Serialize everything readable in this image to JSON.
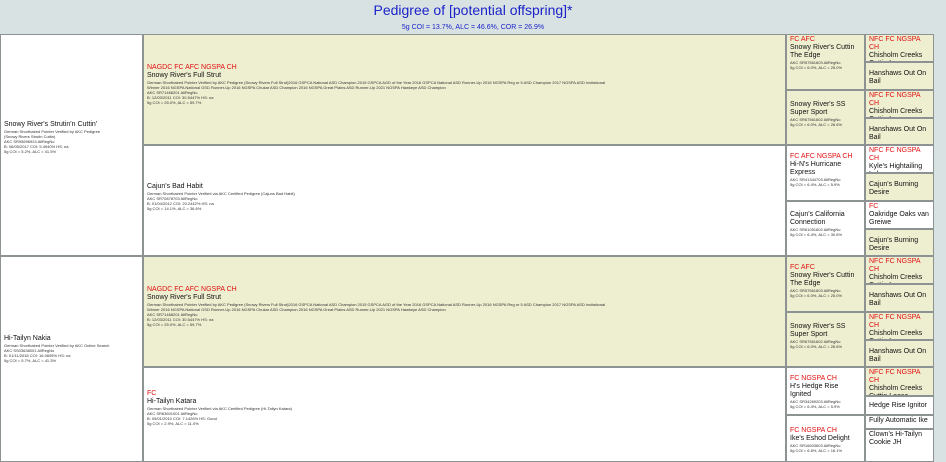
{
  "header": {
    "title": "Pedigree of [potential offspring]*",
    "stats": "5g COI = 13.7%, ALC = 46.6%, COR = 26.9%"
  },
  "sire": {
    "name": "Snowy River's Strutin'n Cuttin'",
    "desc": "German Shorthaired Pointer Verified by AKC Pedigree",
    "desc2": "(Snowy Rivers Strutin Cuttin)",
    "reg": "AKC SR95696924 AllRegNo",
    "dob": "B: 06/05/2017 COI: 5.4940% HS: na",
    "coi": "5g COI = 5.2%, ALC = 41.5%",
    "sire": {
      "title": "NAGDC FC AFC NGSPA CH",
      "name": "Snowy River's Full Strut",
      "desc": "German Shorthaired Pointer Verified by AKC Pedigree (Snowy Rivers Full Strut)2016 GSPCA National ASD Champion 2015 GSPCA AGD of the Year 2016 GSPCA National ASD Runner-Up 2016 NGSPA Reg or 5 ASD Champion 2017 NGSPA ASD Invitational",
      "desc2": "Winner 2016 NGSPA National GSD Runner-Up 2016 NGSPA Chukar ASD Champion 2016 NGSPA Great Plains ASD Runner-Up 2021 NGSPA Hawkeye ASD Champion",
      "reg": "AKC SR71468201 AllRegNo",
      "dob": "B: 12/03/2011 COI: 30.5447% HS: na",
      "coi": "5g COI = 25.0%, ALC = 59.7%",
      "sire": {
        "title": "FC AFC",
        "name": "Snowy River's Cuttin The Edge",
        "reg": "AKC SR57561603 AllRegNo",
        "coi": "5g COI = 6.0%, ALC = 25.0%",
        "sire": {
          "title": "NFC FC NGSPA CH",
          "name": "Chisholm Creeks Cuttin Loose"
        },
        "dam": {
          "title": "",
          "name": "Hanshaws Out On Bail"
        }
      },
      "dam": {
        "title": "",
        "name": "Snowy River's SS Super Sport",
        "reg": "AKC SR67561602 AllRegNo",
        "coi": "5g COI = 6.0%, ALC = 26.6%",
        "sire": {
          "title": "NFC FC NGSPA CH",
          "name": "Chisholm Creeks Cuttin Loose"
        },
        "dam": {
          "title": "",
          "name": "Hanshaws Out On Bail"
        }
      }
    },
    "dam": {
      "title": "",
      "name": "Cajun's Bad Habit",
      "desc": "German Shorthaired Pointer Verified via AKC Certified Pedigree (Cajuns Bad Habit)",
      "reg": "AKC SR70878703 AllRegNo",
      "dob": "B: 01/04/2012 COI: 20.2442% HS: na",
      "coi": "5g COI = 14.1%, ALC = 36.6%",
      "sire": {
        "title": "FC AFC NGSPA CH",
        "name": "Hi-N's Hurricane Express",
        "reg": "AKC SR41344703 AllRegNo",
        "coi": "5g COI = 6.4%, ALC = 5.9%",
        "sire": {
          "title": "NFC FC NGSPA CH",
          "name": "Kyle's Hightailing Luke"
        },
        "dam": {
          "title": "",
          "name": "Cajun's Burning Desire"
        }
      },
      "dam": {
        "title": "",
        "name": "Cajun's California Connection",
        "reg": "AKC SR61051602 AllRegNo",
        "coi": "5g COI = 6.4%, ALC = 30.6%",
        "sire": {
          "title": "FC",
          "name": "Oakridge Oaks van Greiwe"
        },
        "dam": {
          "title": "",
          "name": "Cajun's Burning Desire"
        }
      }
    }
  },
  "dam": {
    "name": "Hi-Tailyn Nakia",
    "desc": "German Shorthaired Pointer Verified by AKC Online Search",
    "reg": "AKC SS03638001 AllRegNo",
    "dob": "B: 01/11/2018 COI: 16.0695% HS: na",
    "coi": "5g COI = 5.7%, ALC = 41.3%",
    "sire": {
      "title": "NAGDC FC AFC NGSPA CH",
      "name": "Snowy River's Full Strut",
      "desc": "German Shorthaired Pointer Verified by AKC Pedigree (Snowy Rivers Full Strut)2016 GSPCA National ASD Champion 2015 GSPCA AGD of the Year 2016 GSPCA National ASD Runner-Up 2016 NGSPA Reg or 5 ASD Champion 2017 NGSPA ASD Invitational",
      "desc2": "Winner 2016 NGSPA National GSD Runner-Up 2016 NGSPA Chukar ASD Champion 2016 NGSPA Great Plains ASD Runner-Up 2021 NGSPA Hawkeye ASD Champion",
      "reg": "AKC SR71468201 AllRegNo",
      "dob": "B: 12/03/2011 COI: 30.5447% HS: na",
      "coi": "5g COI = 25.0%, ALC = 59.7%",
      "sire": {
        "title": "FC AFC",
        "name": "Snowy River's Cuttin The Edge",
        "reg": "AKC SR57561603 AllRegNo",
        "coi": "5g COI = 6.0%, ALC = 25.0%",
        "sire": {
          "title": "NFC FC NGSPA CH",
          "name": "Chisholm Creeks Cuttin Loose"
        },
        "dam": {
          "title": "",
          "name": "Hanshaws Out On Bail"
        }
      },
      "dam": {
        "title": "",
        "name": "Snowy River's SS Super Sport",
        "reg": "AKC SR67561602 AllRegNo",
        "coi": "5g COI = 6.0%, ALC = 26.6%",
        "sire": {
          "title": "NFC FC NGSPA CH",
          "name": "Chisholm Creeks Cuttin Loose"
        },
        "dam": {
          "title": "",
          "name": "Hanshaws Out On Bail"
        }
      }
    },
    "dam": {
      "title": "FC",
      "name": "Hi-Tailyn Katara",
      "desc": "German Shorthaired Pointer Verified via AKC Certified Pedigree (Hi-Tailyn Katara)",
      "reg": "AKC SR63601001 AllRegNo",
      "dob": "B: 05/01/2010 COI: 7.1426% HS: Good",
      "coi": "5g COI = 2.9%, ALC = 11.0%",
      "sire": {
        "title": "FC NGSPA CH",
        "name": "H's Hedge Rise Ignited",
        "reg": "AKC SR34269203 AllRegNo",
        "coi": "5g COI = 6.4%, ALC = 5.9%",
        "sire": {
          "title": "NFC FC NGSPA CH",
          "name": "Chisholm Creeks Cuttin Loose"
        },
        "dam": {
          "title": "",
          "name": "Hedge Rise Ignitor"
        }
      },
      "dam": {
        "title": "FC NGSPA CH",
        "name": "Ike's Eshod Delight",
        "reg": "AKC SR16603603 AllRegNo",
        "coi": "5g COI = 6.6%, ALC = 16.1%",
        "sire": {
          "title": "",
          "name": "Fully Automatic Ike"
        },
        "dam": {
          "title": "",
          "name": "Clown's Hi-Tailyn Cookie JH"
        }
      }
    }
  }
}
